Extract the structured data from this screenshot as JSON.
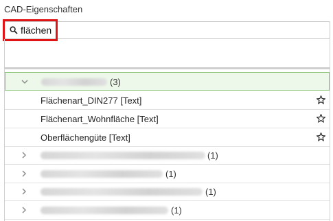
{
  "panel": {
    "title": "CAD-Eigenschaften"
  },
  "search": {
    "value": "flächen",
    "placeholder": ""
  },
  "tree": {
    "expanded_group": {
      "count": "(3)"
    },
    "children": [
      {
        "label": "Flächenart_DIN277 [Text]"
      },
      {
        "label": "Flächenart_Wohnfläche [Text]"
      },
      {
        "label": "Oberflächengüte [Text]"
      }
    ],
    "collapsed_groups": [
      {
        "count": "(1)"
      },
      {
        "count": "(1)"
      },
      {
        "count": "(1)"
      },
      {
        "count": "(1)"
      }
    ]
  },
  "colors": {
    "highlight": "#e01414",
    "selected_bg": "#eef8ea",
    "selected_border": "#8cc47a"
  },
  "icons": {
    "search": "search-icon",
    "star": "star-outline-icon",
    "expand": "chevron-right-icon",
    "collapse": "chevron-down-icon"
  }
}
